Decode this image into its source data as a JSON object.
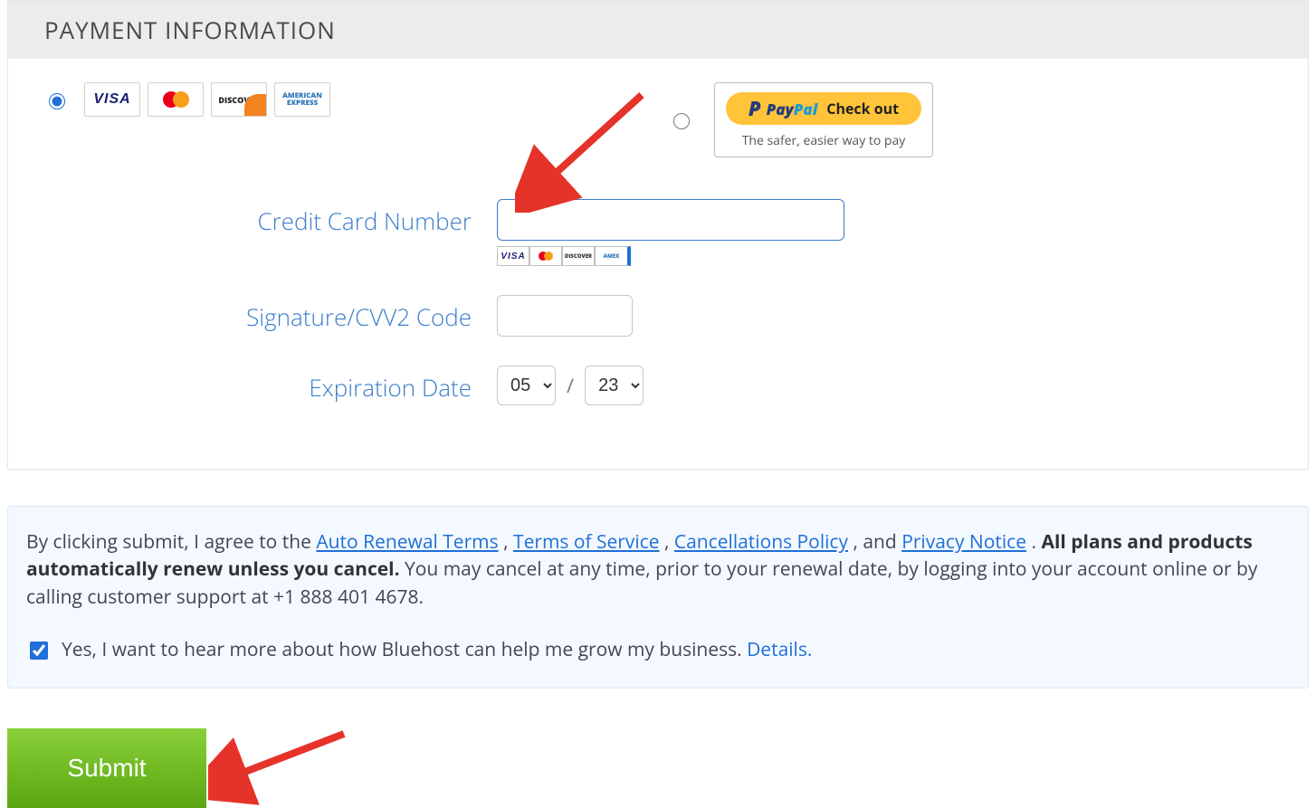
{
  "header": {
    "title": "PAYMENT INFORMATION"
  },
  "methods": {
    "cc_selected": true,
    "card_brands": [
      "VISA",
      "MasterCard",
      "DISCOVER",
      "AMERICAN EXPRESS"
    ],
    "paypal": {
      "brand_pay": "Pay",
      "brand_pal": "Pal",
      "checkout": "Check out",
      "tagline": "The safer, easier way to pay"
    }
  },
  "form": {
    "cc_label": "Credit Card Number",
    "cc_value": "",
    "mini_brands": [
      "VISA",
      "MC",
      "DISCOVER",
      "AMEX"
    ],
    "cvv_label": "Signature/CVV2 Code",
    "cvv_value": "",
    "exp_label": "Expiration Date",
    "exp_month": "05",
    "exp_year": "23"
  },
  "legal": {
    "prefix": "By clicking submit, I agree to the ",
    "link_auto": "Auto Renewal Terms",
    "sep1": ", ",
    "link_tos": "Terms of Service",
    "sep2": ", ",
    "link_cancel": "Cancellations Policy",
    "sep3": ", and ",
    "link_privacy": "Privacy Notice",
    "sep4": ". ",
    "bold": "All plans and products automatically renew unless you cancel.",
    "tail": " You may cancel at any time, prior to your renewal date, by logging into your account online or by calling customer support at +1 888 401 4678."
  },
  "optin": {
    "checked": true,
    "text": "Yes, I want to hear more about how Bluehost can help me grow my business. ",
    "details": "Details."
  },
  "submit": {
    "label": "Submit"
  }
}
